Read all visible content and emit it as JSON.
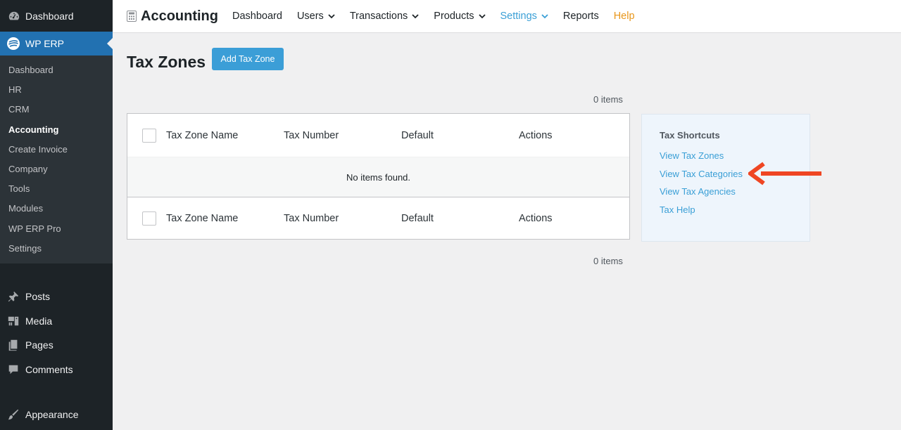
{
  "sidebar": {
    "top_item": {
      "label": "Dashboard",
      "icon": "dashboard-icon"
    },
    "wp_erp": {
      "label": "WP ERP",
      "icon": "wp-erp-logo-icon"
    },
    "submenu": [
      {
        "label": "Dashboard",
        "current": false
      },
      {
        "label": "HR",
        "current": false
      },
      {
        "label": "CRM",
        "current": false
      },
      {
        "label": "Accounting",
        "current": true
      },
      {
        "label": "Create Invoice",
        "current": false
      },
      {
        "label": "Company",
        "current": false
      },
      {
        "label": "Tools",
        "current": false
      },
      {
        "label": "Modules",
        "current": false
      },
      {
        "label": "WP ERP Pro",
        "current": false
      },
      {
        "label": "Settings",
        "current": false
      }
    ],
    "menu": [
      {
        "label": "Posts",
        "icon": "pin-icon"
      },
      {
        "label": "Media",
        "icon": "media-icon"
      },
      {
        "label": "Pages",
        "icon": "pages-icon"
      },
      {
        "label": "Comments",
        "icon": "comment-icon"
      },
      {
        "label": "Appearance",
        "icon": "brush-icon"
      }
    ]
  },
  "topnav": {
    "brand": "Accounting",
    "brand_icon": "calculator-icon",
    "items": [
      {
        "label": "Dashboard",
        "dropdown": false
      },
      {
        "label": "Users",
        "dropdown": true
      },
      {
        "label": "Transactions",
        "dropdown": true
      },
      {
        "label": "Products",
        "dropdown": true
      },
      {
        "label": "Settings",
        "dropdown": true,
        "active": true
      },
      {
        "label": "Reports",
        "dropdown": false
      },
      {
        "label": "Help",
        "dropdown": false
      }
    ]
  },
  "main": {
    "title": "Tax Zones",
    "add_button": "Add Tax Zone",
    "count_top": "0 items",
    "count_bottom": "0 items",
    "columns": [
      "Tax Zone Name",
      "Tax Number",
      "Default",
      "Actions"
    ],
    "empty_message": "No items found."
  },
  "shortcuts": {
    "title": "Tax Shortcuts",
    "links": [
      "View Tax Zones",
      "View Tax Categories",
      "View Tax Agencies",
      "Tax Help"
    ]
  },
  "colors": {
    "sidebar_bg": "#1d2327",
    "accent_blue": "#2271b1",
    "link_blue": "#3a9fd6",
    "help_orange": "#e8961a",
    "arrow_red": "#ef4623"
  }
}
